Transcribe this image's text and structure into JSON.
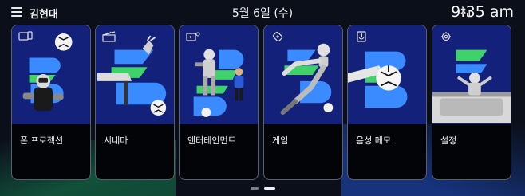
{
  "header": {
    "user_name": "김현대",
    "date": "5월 6일 (수)",
    "time": "9:35 am"
  },
  "cards": [
    {
      "label": "폰 프로젝션",
      "icon": "phone-projection-icon"
    },
    {
      "label": "시네마",
      "icon": "clapperboard-icon"
    },
    {
      "label": "엔터테인먼트",
      "icon": "media-player-icon"
    },
    {
      "label": "게임",
      "icon": "game-controller-icon"
    },
    {
      "label": "음성 메모",
      "icon": "voice-memo-icon"
    },
    {
      "label": "설정",
      "icon": "gear-icon"
    }
  ],
  "pagination": {
    "pages": 2,
    "active": 2
  },
  "colors": {
    "card_bg": "#13217a",
    "accent_green": "#3fd16a",
    "accent_blue": "#3a8bff",
    "border": "#5b6071"
  }
}
